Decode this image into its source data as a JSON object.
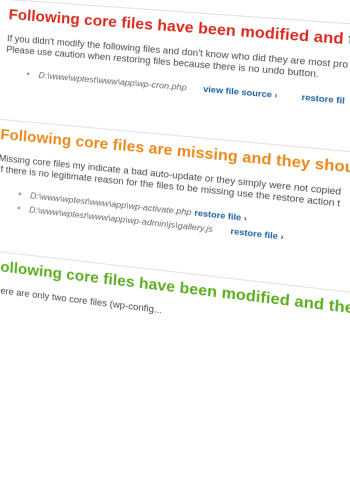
{
  "sections": [
    {
      "title": "Following core files have been modified and they should",
      "desc_lines": [
        "If you didn't modify the following files and don't know who did they are most pro",
        "Please use caution when restoring files because there is no undo button."
      ],
      "files": [
        {
          "path": "D:\\www\\wptest\\www\\app\\wp-cron.php",
          "view_label": "view file source ›",
          "restore_label": "restore fil"
        }
      ]
    },
    {
      "title": "Following core files are missing and they should not be",
      "desc_lines": [
        "Missing core files my indicate a bad auto-update or they simply were not copied",
        "If there is no legitimate reason for the files to be missing use the restore action t"
      ],
      "files": [
        {
          "path": "D:\\www\\wptest\\www\\app\\wp-activate.php",
          "restore_label": "restore file ›"
        },
        {
          "path": "D:\\www\\wptest\\www\\app\\wp-admin\\js\\gallery.js",
          "restore_label": "restore file ›"
        }
      ]
    },
    {
      "title": "Following core files have been modified and they are sup",
      "desc_lines": [
        "There are only two core files (wp-config..."
      ]
    }
  ],
  "colors": {
    "red": "#d9291c",
    "orange": "#e8891a",
    "green": "#5aad1c",
    "link": "#1b5e9e"
  }
}
